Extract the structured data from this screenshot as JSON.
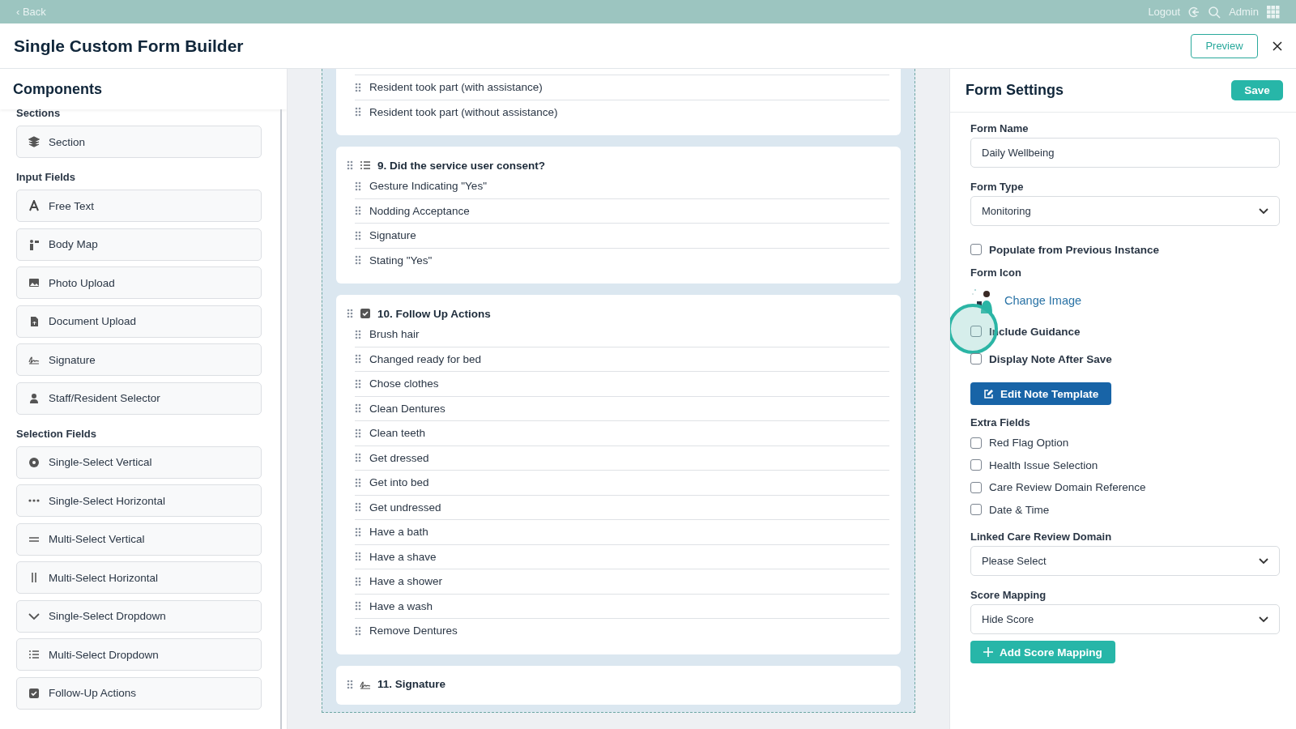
{
  "topbar": {
    "back": "‹ Back",
    "logout": "Logout",
    "user": "Admin"
  },
  "header": {
    "title": "Single Custom Form Builder",
    "preview": "Preview"
  },
  "components": {
    "title": "Components",
    "groups": [
      {
        "heading": "Sections",
        "items": [
          {
            "label": "Section",
            "kind": "layers"
          }
        ]
      },
      {
        "heading": "Input Fields",
        "items": [
          {
            "label": "Free Text",
            "kind": "letter"
          },
          {
            "label": "Body Map",
            "kind": "bodymap"
          },
          {
            "label": "Photo Upload",
            "kind": "photo"
          },
          {
            "label": "Document Upload",
            "kind": "document"
          },
          {
            "label": "Signature",
            "kind": "signature"
          },
          {
            "label": "Staff/Resident Selector",
            "kind": "person"
          }
        ]
      },
      {
        "heading": "Selection Fields",
        "items": [
          {
            "label": "Single-Select Vertical",
            "kind": "radio"
          },
          {
            "label": "Single-Select Horizontal",
            "kind": "dots"
          },
          {
            "label": "Multi-Select Vertical",
            "kind": "lines"
          },
          {
            "label": "Multi-Select Horizontal",
            "kind": "bars"
          },
          {
            "label": "Single-Select Dropdown",
            "kind": "chevron"
          },
          {
            "label": "Multi-Select Dropdown",
            "kind": "list"
          },
          {
            "label": "Follow-Up Actions",
            "kind": "checkbox"
          }
        ]
      }
    ]
  },
  "canvas": {
    "cards": [
      {
        "items": [
          "Resident took part (with assistance)",
          "Resident took part (without assistance)"
        ]
      },
      {
        "title": "9. Did the service user consent?",
        "kind": "list",
        "items": [
          "Gesture Indicating \"Yes\"",
          "Nodding Acceptance",
          "Signature",
          "Stating \"Yes\""
        ]
      },
      {
        "title": "10. Follow Up Actions",
        "kind": "checkbox",
        "items": [
          "Brush hair",
          "Changed ready for bed",
          "Chose clothes",
          "Clean Dentures",
          "Clean teeth",
          "Get dressed",
          "Get into bed",
          "Get undressed",
          "Have a bath",
          "Have a shave",
          "Have a shower",
          "Have a wash",
          "Remove Dentures"
        ]
      },
      {
        "title": "11. Signature",
        "kind": "signature"
      }
    ]
  },
  "settings": {
    "title": "Form Settings",
    "save": "Save",
    "form_name": {
      "label": "Form Name",
      "value": "Daily Wellbeing"
    },
    "form_type": {
      "label": "Form Type",
      "value": "Monitoring"
    },
    "populate": {
      "label": "Populate from Previous Instance",
      "checked": false
    },
    "form_icon": {
      "label": "Form Icon",
      "link": "Change Image"
    },
    "options": [
      {
        "label": "Include Guidance",
        "checked": false,
        "highlighted": true
      },
      {
        "label": "Display Note After Save",
        "checked": false,
        "highlighted": false
      }
    ],
    "edit_note": "Edit Note Template",
    "extra_fields": {
      "heading": "Extra Fields",
      "items": [
        {
          "label": "Red Flag Option",
          "checked": false
        },
        {
          "label": "Health Issue Selection",
          "checked": false
        },
        {
          "label": "Care Review Domain Reference",
          "checked": false
        },
        {
          "label": "Date & Time",
          "checked": false
        }
      ]
    },
    "linked_domain": {
      "label": "Linked Care Review Domain",
      "value": "Please Select"
    },
    "score_mapping": {
      "label": "Score Mapping",
      "value": "Hide Score"
    },
    "add_score": "Add Score Mapping"
  }
}
